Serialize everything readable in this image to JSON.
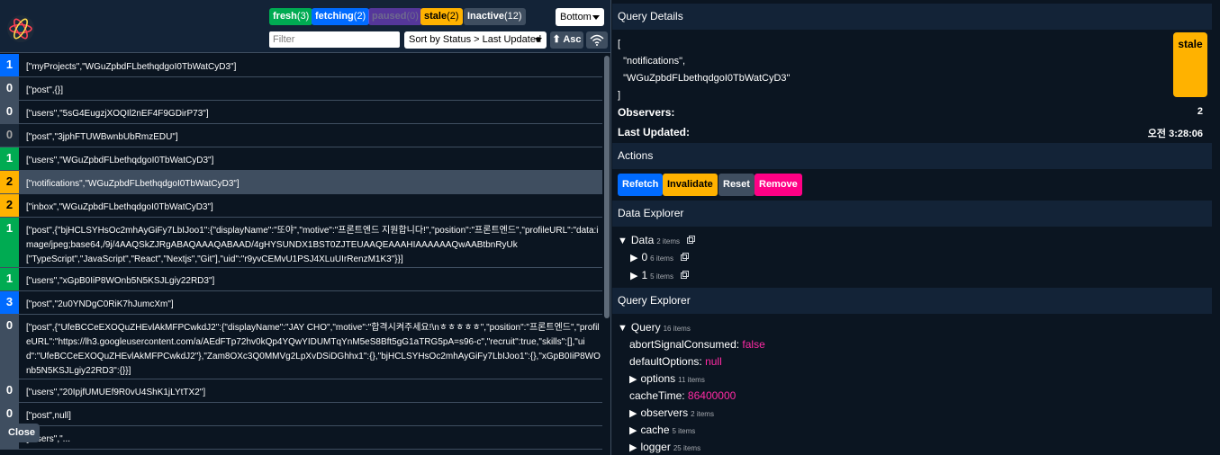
{
  "filters": {
    "fresh": {
      "label": "fresh",
      "count": "(3)"
    },
    "fetching": {
      "label": "fetching",
      "count": "(2)"
    },
    "paused": {
      "label": "paused",
      "count": "(0)"
    },
    "stale": {
      "label": "stale",
      "count": "(2)"
    },
    "inactive": {
      "label": "Inactive",
      "count": "(12)"
    }
  },
  "position_select": "Bottom",
  "filter_placeholder": "Filter",
  "sort_select": "Sort by Status > Last Updated",
  "sort_dir_label": "⬆ Asc",
  "close_label": "Close",
  "queries": [
    {
      "count": "1",
      "color": "blue",
      "key": "[\"myProjects\",\"WGuZpbdFLbethqdgoI0TbWatCyD3\"]"
    },
    {
      "count": "0",
      "color": "grey",
      "key": "[\"post\",{}]"
    },
    {
      "count": "0",
      "color": "grey",
      "key": "[\"users\",\"5sG4EugzjXOQIl2nEF4F9GDirP73\"]"
    },
    {
      "count": "0",
      "color": "dark",
      "key": "[\"post\",\"3jphFTUWBwnbUbRmzEDU\"]"
    },
    {
      "count": "1",
      "color": "green",
      "key": "[\"users\",\"WGuZpbdFLbethqdgoI0TbWatCyD3\"]"
    },
    {
      "count": "2",
      "color": "yellow",
      "key": "[\"notifications\",\"WGuZpbdFLbethqdgoI0TbWatCyD3\"]",
      "selected": true
    },
    {
      "count": "2",
      "color": "yellow",
      "key": "[\"inbox\",\"WGuZpbdFLbethqdgoI0TbWatCyD3\"]"
    },
    {
      "count": "1",
      "color": "green",
      "key": "[\"post\",{\"bjHCLSYHsOc2mhAyGiFy7LbIJoo1\":{\"displayName\":\"또야\",\"motive\":\"프론트엔드 지원합니다!\",\"position\":\"프론트엔드\",\"profileURL\":\"data:image/jpeg;base64,/9j/4AAQSkZJRgABAQAAAQABAAD/4gHYSUNDX1BST0ZJTEUAAQEAAAHIAAAAAAQwAABtbnRyUk\n[\"TypeScript\",\"JavaScript\",\"React\",\"Nextjs\",\"Git\"],\"uid\":\"r9yvCEMvU1PSJ4XLuUIrRenzM1K3\"}}]"
    },
    {
      "count": "1",
      "color": "green",
      "key": "[\"users\",\"xGpB0IiP8WOnb5N5KSJLgiy22RD3\"]"
    },
    {
      "count": "3",
      "color": "blue",
      "key": "[\"post\",\"2u0YNDgC0RiK7hJumcXm\"]"
    },
    {
      "count": "0",
      "color": "grey",
      "key": "[\"post\",{\"UfeBCCeEXOQuZHEvlAkMFPCwkdJ2\":{\"displayName\":\"JAY CHO\",\"motive\":\"합격시켜주세요!\\nㅎㅎㅎㅎㅎ\",\"position\":\"프론트엔드\",\"profileURL\":\"https://lh3.googleusercontent.com/a/AEdFTp72hv0kQp4YQwYIDUMTqYnM5eS8Bft5gG1aTRG5pA=s96-c\",\"recruit\":true,\"skills\":[],\"uid\":\"UfeBCCeEXOQuZHEvlAkMFPCwkdJ2\"},\"Zam8OXc3Q0MMVg2LpXvDSiDGhhx1\":{},\"bjHCLSYHsOc2mhAyGiFy7LbIJoo1\":{},\"xGpB0IiP8WOnb5N5KSJLgiy22RD3\":{}}]"
    },
    {
      "count": "0",
      "color": "grey",
      "key": "[\"users\",\"20IpjfUMUEf9R0vU4ShK1jLYtTX2\"]"
    },
    {
      "count": "0",
      "color": "grey",
      "key": "[\"post\",null]"
    },
    {
      "count": "0",
      "color": "grey",
      "key": "[\"users\",\"..."
    }
  ],
  "details": {
    "header": "Query Details",
    "key": "[\n  \"notifications\",\n  \"WGuZpbdFLbethqdgoI0TbWatCyD3\"\n]",
    "status": "stale",
    "observers_label": "Observers:",
    "observers_value": "2",
    "updated_label": "Last Updated:",
    "updated_value": "오전 3:28:06"
  },
  "actions": {
    "header": "Actions",
    "refetch": "Refetch",
    "invalidate": "Invalidate",
    "reset": "Reset",
    "remove": "Remove"
  },
  "data_explorer": {
    "header": "Data Explorer",
    "root_label": "Data",
    "root_count": "2 items",
    "items": [
      {
        "label": "0",
        "count": "6 items"
      },
      {
        "label": "1",
        "count": "5 items"
      }
    ]
  },
  "query_explorer": {
    "header": "Query Explorer",
    "root_label": "Query",
    "root_count": "16 items",
    "abortSignalConsumed_label": "abortSignalConsumed:",
    "abortSignalConsumed_value": "false",
    "defaultOptions_label": "defaultOptions:",
    "defaultOptions_value": "null",
    "options_label": "options",
    "options_count": "11 items",
    "cacheTime_label": "cacheTime:",
    "cacheTime_value": "86400000",
    "observers_label": "observers",
    "observers_count": "2 items",
    "cache_label": "cache",
    "cache_count": "5 items",
    "logger_label": "logger",
    "logger_count": "25 items"
  },
  "colors": {
    "blue": "#006bff",
    "green": "#00ab52",
    "yellow": "#ffb200",
    "grey": "#3f4e60",
    "pink": "#ff0085"
  }
}
